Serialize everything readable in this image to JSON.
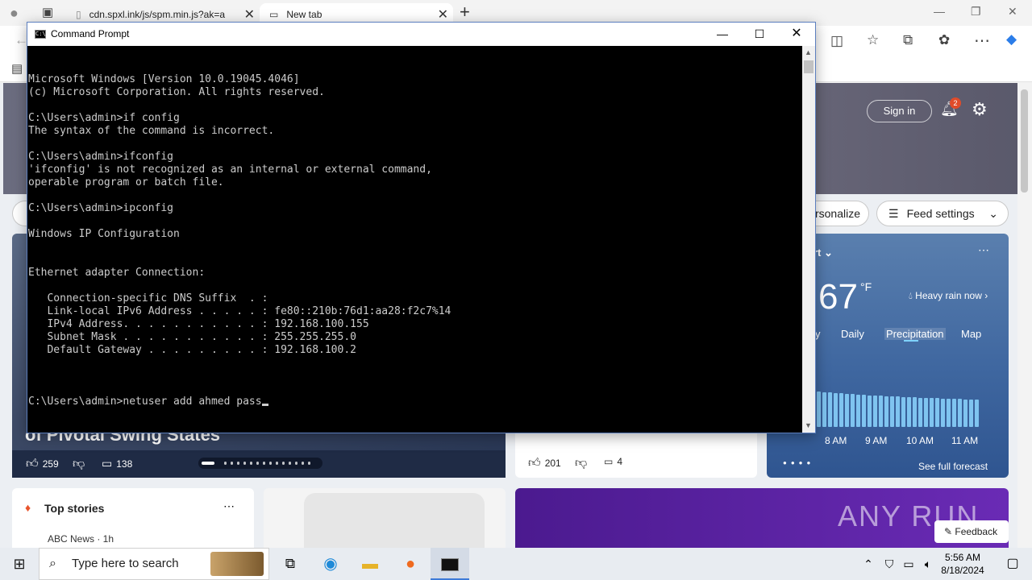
{
  "browser": {
    "tabs": [
      {
        "title": "cdn.spxl.ink/js/spm.min.js?ak=a",
        "close": "✕"
      },
      {
        "title": "New tab",
        "close": "✕"
      }
    ],
    "new_tab": "+",
    "window_controls": {
      "minimize": "—",
      "restore": "❐",
      "close": "✕"
    }
  },
  "msn": {
    "sign_in": "Sign in",
    "notification_count": "2",
    "personalize": "ersonalize",
    "feed_settings": "Feed settings",
    "hero_headline": "of Pivotal Swing States",
    "hero_likes": "259",
    "hero_comments": "138",
    "mid_likes": "201",
    "mid_comments": "4",
    "weather": {
      "location": "urt",
      "temp": "67",
      "unit": "°F",
      "condition": "Heavy rain now",
      "tabs": [
        "y",
        "Daily",
        "Precipitation",
        "Map"
      ],
      "active_tab": "Precipitation",
      "hours": [
        "8 AM",
        "9 AM",
        "10 AM",
        "11 AM"
      ],
      "forecast_link": "See full forecast"
    },
    "top_stories": "Top stories",
    "story_source": "ABC News · 1h",
    "feedback": "Feedback",
    "watermark": "ANY RUN"
  },
  "cmd": {
    "title": "Command Prompt",
    "icon_text": "C:\\",
    "lines": [
      "Microsoft Windows [Version 10.0.19045.4046]",
      "(c) Microsoft Corporation. All rights reserved.",
      "",
      "C:\\Users\\admin>if config",
      "The syntax of the command is incorrect.",
      "",
      "C:\\Users\\admin>ifconfig",
      "'ifconfig' is not recognized as an internal or external command,",
      "operable program or batch file.",
      "",
      "C:\\Users\\admin>ipconfig",
      "",
      "Windows IP Configuration",
      "",
      "",
      "Ethernet adapter Connection:",
      "",
      "   Connection-specific DNS Suffix  . :",
      "   Link-local IPv6 Address . . . . . : fe80::210b:76d1:aa28:f2c7%14",
      "   IPv4 Address. . . . . . . . . . . : 192.168.100.155",
      "   Subnet Mask . . . . . . . . . . . : 255.255.255.0",
      "   Default Gateway . . . . . . . . . : 192.168.100.2",
      ""
    ],
    "current_input": "C:\\Users\\admin>netuser add ahmed pass"
  },
  "taskbar": {
    "search_placeholder": "Type here to search",
    "time": "5:56 AM",
    "date": "8/18/2024"
  }
}
